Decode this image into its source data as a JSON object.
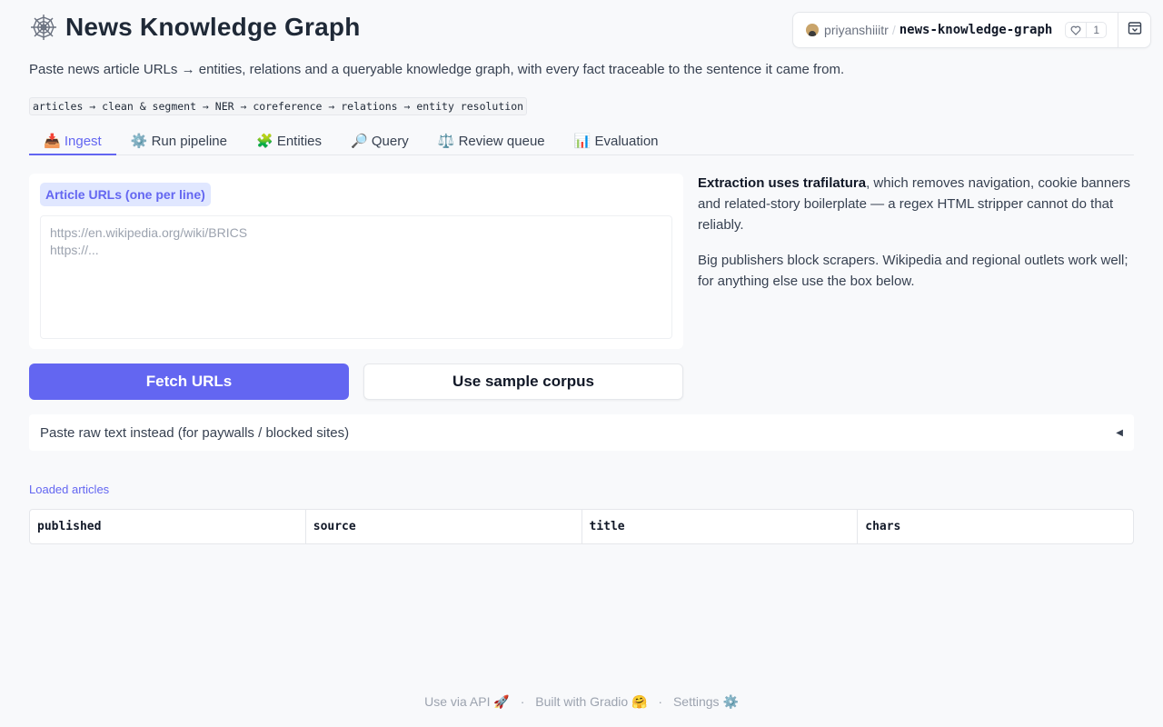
{
  "header": {
    "title": "News Knowledge Graph",
    "subtitle": "Paste news article URLs → entities, relations and a queryable knowledge graph, with every fact traceable to the sentence it came from.",
    "pipeline": "articles → clean & segment → NER → coreference → relations → entity resolution"
  },
  "space": {
    "owner": "priyanshiiitr",
    "separator": "/",
    "repo": "news-knowledge-graph",
    "likes": "1"
  },
  "tabs": [
    {
      "label": "📥 Ingest",
      "active": true
    },
    {
      "label": "⚙️ Run pipeline"
    },
    {
      "label": "🧩 Entities"
    },
    {
      "label": "🔎 Query"
    },
    {
      "label": "⚖️ Review queue"
    },
    {
      "label": "📊 Evaluation"
    }
  ],
  "ingest": {
    "urls_label": "Article URLs (one per line)",
    "urls_placeholder": "https://en.wikipedia.org/wiki/BRICS\nhttps://...",
    "fetch_button": "Fetch URLs",
    "sample_button": "Use sample corpus",
    "info_bold": "Extraction uses trafilatura",
    "info_rest": ", which removes navigation, cookie banners and related-story boilerplate — a regex HTML stripper cannot do that reliably.",
    "info_p2": "Big publishers block scrapers. Wikipedia and regional outlets work well; for anything else use the box below.",
    "accordion_label": "Paste raw text instead (for paywalls / blocked sites)",
    "loaded_label": "Loaded articles",
    "columns": [
      "published",
      "source",
      "title",
      "chars"
    ]
  },
  "footer": {
    "api": "Use via API 🚀",
    "built": "Built with Gradio 🤗",
    "settings": "Settings ⚙️",
    "sep": "·"
  }
}
